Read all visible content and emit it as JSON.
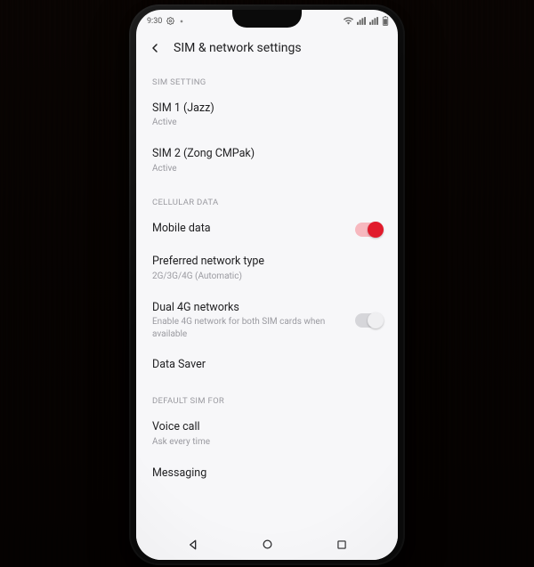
{
  "status": {
    "time": "9:30",
    "gear_icon": "gear",
    "right_icons": [
      "wifi",
      "signal",
      "signal",
      "battery"
    ]
  },
  "header": {
    "title": "SIM & network settings"
  },
  "sections": {
    "sim_setting": {
      "label": "SIM SETTING",
      "sim1": {
        "title": "SIM 1  (Jazz)",
        "sub": "Active"
      },
      "sim2": {
        "title": "SIM 2  (Zong CMPak)",
        "sub": "Active"
      }
    },
    "cellular": {
      "label": "CELLULAR DATA",
      "mobile_data": {
        "title": "Mobile data",
        "on": true
      },
      "preferred": {
        "title": "Preferred network type",
        "sub": "2G/3G/4G (Automatic)"
      },
      "dual4g": {
        "title": "Dual 4G networks",
        "sub": "Enable 4G network for both SIM cards when available",
        "on": false
      },
      "data_saver": {
        "title": "Data Saver"
      }
    },
    "default_sim": {
      "label": "DEFAULT SIM FOR",
      "voice": {
        "title": "Voice call",
        "sub": "Ask every time"
      },
      "messaging": {
        "title": "Messaging"
      }
    }
  }
}
